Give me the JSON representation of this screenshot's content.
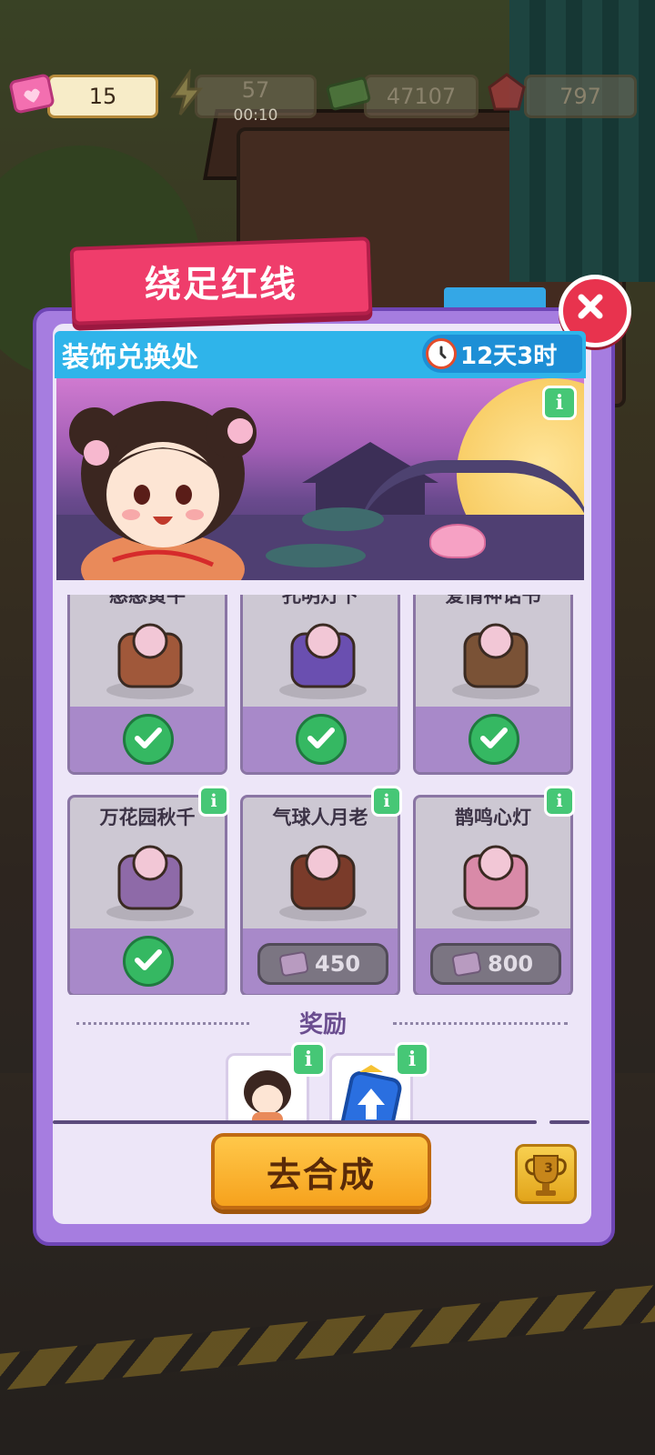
{
  "currency": {
    "tickets": "15",
    "energy": "57",
    "energy_timer": "00:10",
    "cash": "47107",
    "gems": "797"
  },
  "modal": {
    "title": "绕足红线",
    "banner_title": "装饰兑换处",
    "time_left": "12天3时",
    "items": [
      {
        "name": "憨憨黄牛",
        "owned": true
      },
      {
        "name": "孔明灯下",
        "owned": true
      },
      {
        "name": "爱情神话书",
        "owned": true
      },
      {
        "name": "万花园秋千",
        "owned": true
      },
      {
        "name": "气球人月老",
        "owned": false,
        "price": "450"
      },
      {
        "name": "鹊鸣心灯",
        "owned": false,
        "price": "800"
      }
    ],
    "rewards_title": "奖励",
    "go_button": "去合成",
    "trophy_level": "3"
  },
  "icons": {
    "ticket": "ticket-icon",
    "energy": "lightning-icon",
    "cash": "cash-icon",
    "gem": "ruby-icon",
    "close": "close-icon",
    "clock": "clock-icon",
    "info": "info-icon",
    "check": "check-icon",
    "trophy": "trophy-icon"
  },
  "colors": {
    "title_ribbon": "#ef3d6b",
    "panel": "#a67de0",
    "banner": "#2fb4ea",
    "go_button": "#f6a21d",
    "check": "#35b862"
  }
}
